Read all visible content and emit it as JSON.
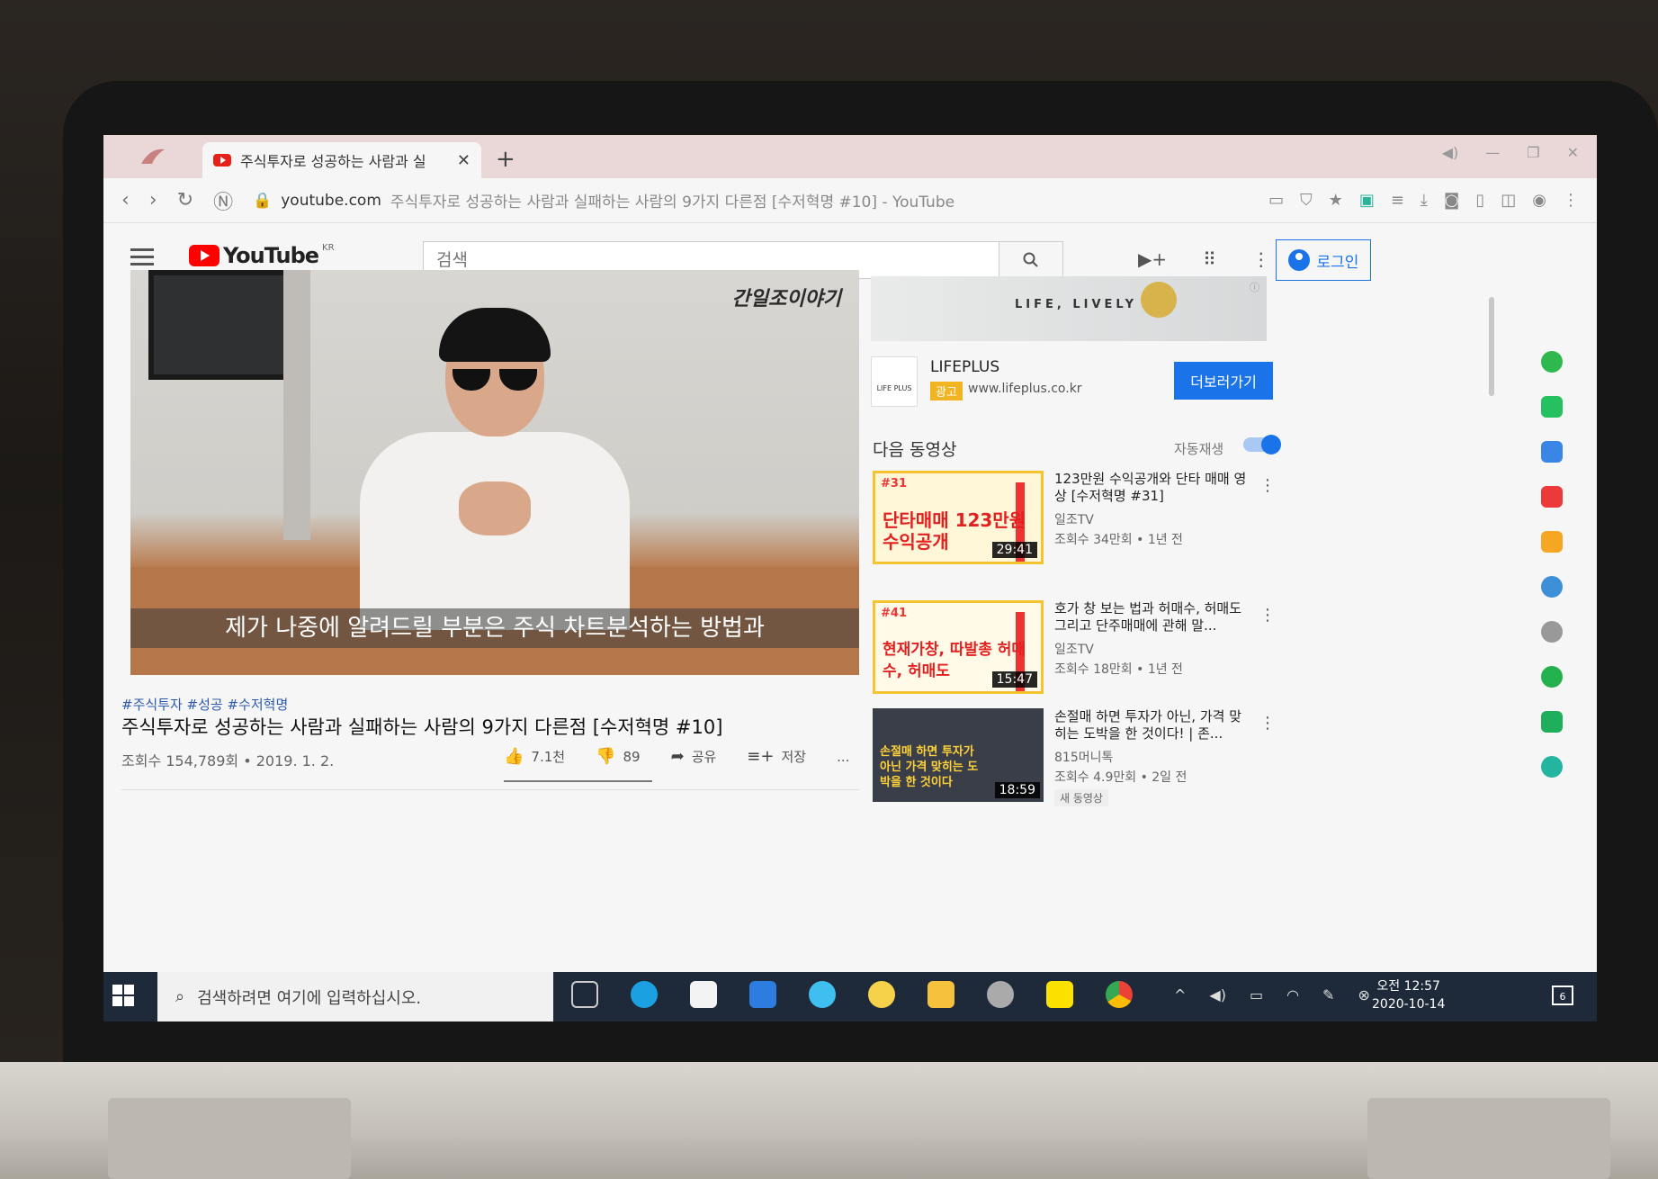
{
  "browser": {
    "tab_title": "주식투자로 성공하는 사람과 실",
    "close_tab": "✕",
    "new_tab": "+",
    "url_host": "youtube.com",
    "url_title": "주식투자로 성공하는 사람과 실패하는 사람의 9가지 다른점 [수저혁명 #10] - YouTube"
  },
  "youtube": {
    "logo_text": "YouTube",
    "logo_region": "KR",
    "search_placeholder": "검색",
    "login_label": "로그인"
  },
  "video": {
    "caption": "제가 나중에 알려드릴 부분은 주식 차트분석하는 방법과",
    "watermark": "간일조이야기",
    "tags": "#주식투자 #성공 #수저혁명",
    "title": "주식투자로 성공하는 사람과 실패하는 사람의 9가지 다른점 [수저혁명 #10]",
    "stats": "조회수 154,789회 • 2019. 1. 2.",
    "likes": "7.1천",
    "dislikes": "89",
    "share_label": "공유",
    "save_label": "저장",
    "more_label": "..."
  },
  "ad": {
    "banner_slogan": "LIFE, LIVELY",
    "logo_text": "LIFE PLUS",
    "name": "LIFEPLUS",
    "badge": "광고",
    "url": "www.lifeplus.co.kr",
    "button": "더보러가기"
  },
  "upnext": {
    "heading": "다음 동영상",
    "autoplay_label": "자동재생",
    "autoplay_on": true,
    "items": [
      {
        "title": "123만원 수익공개와 단타 매매 영상 [수저혁명 #31]",
        "channel": "일조TV",
        "meta": "조회수 34만회 • 1년 전",
        "duration": "29:41",
        "thumb_tag": "#31",
        "thumb_text": "단타매매 123만원 수익공개",
        "new_badge": ""
      },
      {
        "title": "호가 창 보는 법과 허매수, 허매도 그리고 단주매매에 관해 말...",
        "channel": "일조TV",
        "meta": "조회수 18만회 • 1년 전",
        "duration": "15:47",
        "thumb_tag": "#41",
        "thumb_text": "현재가창, 따발총 허매수, 허매도",
        "new_badge": ""
      },
      {
        "title": "손절매 하면 투자가 아닌, 가격 맞히는 도박을 한 것이다! | 존...",
        "channel": "815머니톡",
        "meta": "조회수 4.9만회 • 2일 전",
        "duration": "18:59",
        "thumb_tag": "",
        "thumb_text": "손절매 하면 투자가 아닌 가격 맞히는 도박을 한 것이다",
        "new_badge": "새 동영상"
      }
    ]
  },
  "taskbar": {
    "search_placeholder": "검색하려면 여기에 입력하십시오.",
    "time": "오전 12:57",
    "date": "2020-10-14",
    "notifications": "6"
  },
  "colors": {
    "youtube_red": "#ff0000",
    "accent_blue": "#1a73e8",
    "taskbar": "#1e2a3a",
    "ad_badge": "#f1b423"
  }
}
